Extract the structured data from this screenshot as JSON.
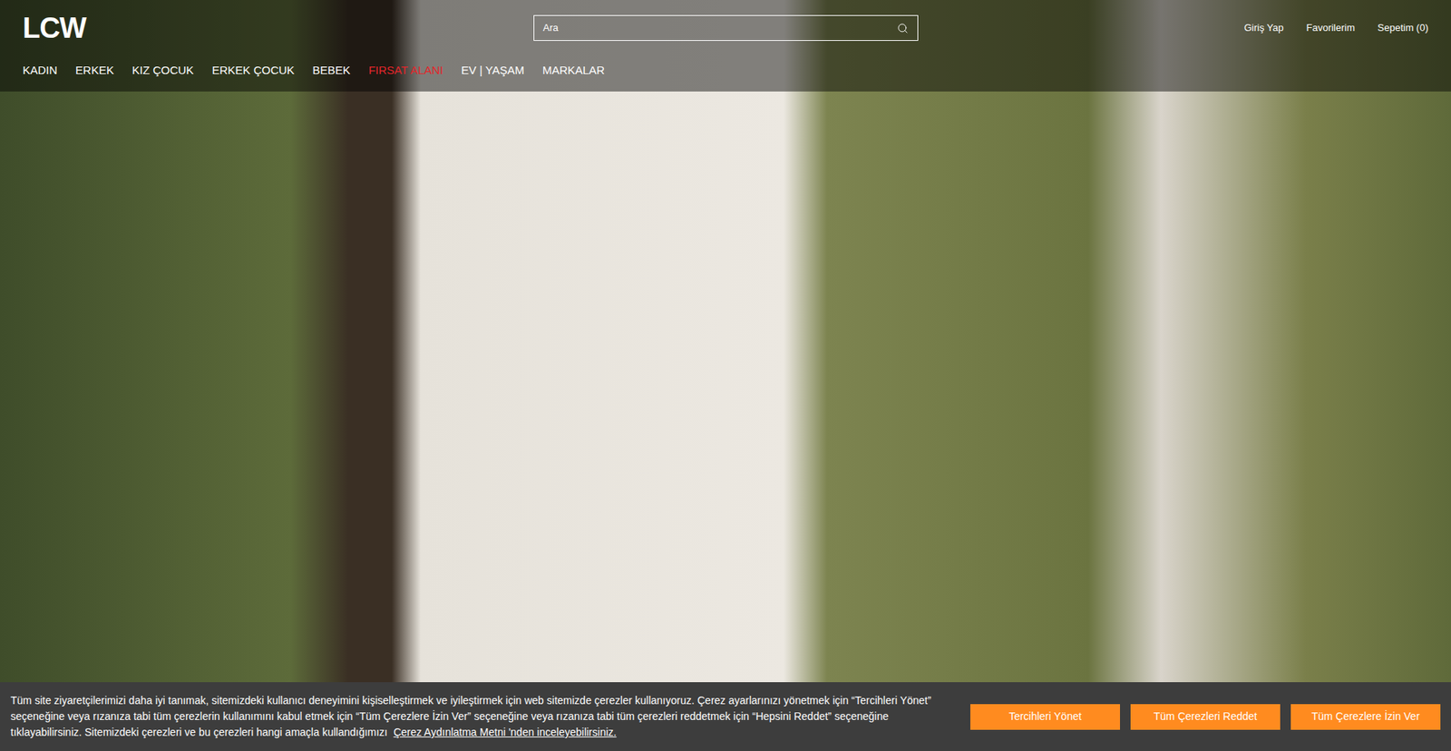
{
  "header": {
    "logo": "LCW",
    "search": {
      "placeholder": "Ara"
    },
    "account_links": [
      "Giriş Yap",
      "Favorilerim",
      "Sepetim (0)"
    ]
  },
  "nav": [
    {
      "label": "KADIN",
      "color": "#ffffff"
    },
    {
      "label": "ERKEK",
      "color": "#ffffff"
    },
    {
      "label": "KIZ ÇOCUK",
      "color": "#ffffff"
    },
    {
      "label": "ERKEK ÇOCUK",
      "color": "#ffffff"
    },
    {
      "label": "BEBEK",
      "color": "#ffffff"
    },
    {
      "label": "FIRSAT ALANI",
      "color": "#e3262b"
    },
    {
      "label": "EV | YAŞAM",
      "color": "#ffffff"
    },
    {
      "label": "MARKALAR",
      "color": "#ffffff"
    }
  ],
  "cookie_banner": {
    "text": "Tüm site ziyaretçilerimizi daha iyi tanımak, sitemizdeki kullanıcı deneyimini kişiselleştirmek ve iyileştirmek için web sitemizde çerezler kullanıyoruz. Çerez ayarlarınızı yönetmek için “Tercihleri Yönet” seçeneğine veya rızanıza tabi tüm çerezlerin kullanımını kabul etmek için “Tüm Çerezlere İzin Ver” seçeneğine veya rızanıza tabi tüm çerezleri reddetmek için “Hepsini Reddet” seçeneğine tıklayabilirsiniz. Sitemizdeki çerezleri ve bu çerezleri hangi amaçla kullandığımızı",
    "link": "Çerez Aydınlatma Metni 'nden inceleyebilirsiniz.",
    "buttons": [
      "Tercihleri Yönet",
      "Tüm Çerezleri Reddet",
      "Tüm Çerezlere İzin Ver"
    ]
  }
}
